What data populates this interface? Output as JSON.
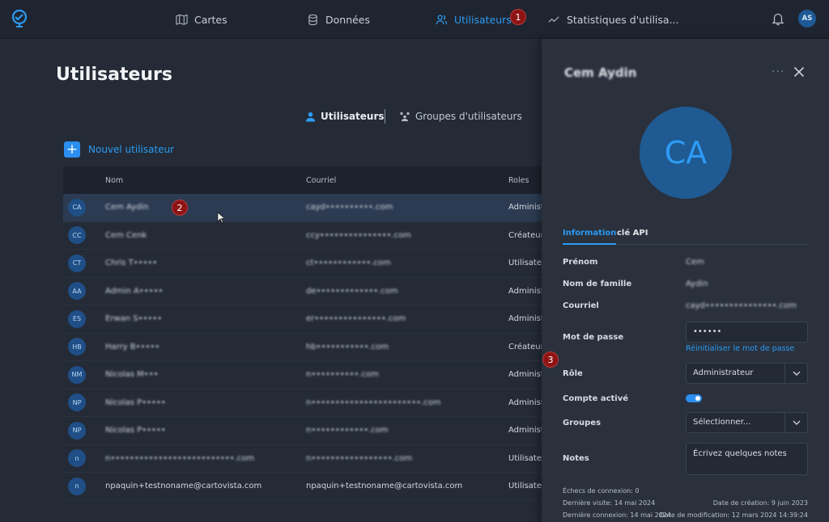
{
  "nav": {
    "items": [
      {
        "label": "Cartes",
        "icon": "map-icon"
      },
      {
        "label": "Données",
        "icon": "database-icon"
      },
      {
        "label": "Utilisateurs",
        "icon": "users-icon"
      },
      {
        "label": "Statistiques d'utilisa...",
        "icon": "stats-icon"
      }
    ],
    "user_initials": "AS"
  },
  "markers": [
    "1",
    "2",
    "3"
  ],
  "page": {
    "title": "Utilisateurs",
    "tab_users": "Utilisateurs",
    "tab_groups": "Groupes d'utilisateurs",
    "new_user": "Nouvel utilisateur"
  },
  "table": {
    "headers": [
      "Nom",
      "Courriel",
      "Roles"
    ],
    "rows": [
      {
        "initials": "CA",
        "name": "Cem Aydin",
        "email": "cayd••••••••••.com",
        "role": "Administrateur",
        "blur": true
      },
      {
        "initials": "CC",
        "name": "Cem Cenk",
        "email": "ccy•••••••••••••••.com",
        "role": "Créateur",
        "blur": true
      },
      {
        "initials": "CT",
        "name": "Chris T•••••",
        "email": "ct••••••••••••.com",
        "role": "Utilisateur",
        "blur": true
      },
      {
        "initials": "AA",
        "name": "Admin A•••••",
        "email": "de•••••••••••••.com",
        "role": "Administrateur",
        "blur": true
      },
      {
        "initials": "ES",
        "name": "Erwan S•••••",
        "email": "er•••••••••••••••.com",
        "role": "Administrateur",
        "blur": true
      },
      {
        "initials": "HB",
        "name": "Harry B•••••",
        "email": "hb•••••••••••.com",
        "role": "Créateur",
        "blur": true
      },
      {
        "initials": "NM",
        "name": "Nicolas M•••",
        "email": "n••••••••••.com",
        "role": "Administrateur",
        "blur": true
      },
      {
        "initials": "NP",
        "name": "Nicolas P•••••",
        "email": "n•••••••••••••••••••••••.com",
        "role": "Administrateur",
        "blur": true
      },
      {
        "initials": "NP",
        "name": "Nicolas P•••••",
        "email": "n••••••••••••.com",
        "role": "Administrateur",
        "blur": true
      },
      {
        "initials": "n",
        "name": "n••••••••••••••••••••••••••.com",
        "email": "n•••••••••••••••••.com",
        "role": "Utilisateur",
        "blur": true
      },
      {
        "initials": "n",
        "name": "npaquin+testnoname@cartovista.com",
        "email": "npaquin+testnoname@cartovista.com",
        "role": "Utilisateur",
        "blur": false
      }
    ]
  },
  "panel": {
    "title": "Cem Aydin",
    "dots": "···",
    "avatar_initials": "CA",
    "tab_info": "Information",
    "tab_api": "clé API",
    "fields": {
      "first_name_label": "Prénom",
      "first_name": "Cem",
      "last_name_label": "Nom de famille",
      "last_name": "Aydin",
      "email_label": "Courriel",
      "email": "cayd•••••••••••••••.com",
      "password_label": "Mot de passe",
      "password": "••••••",
      "reset_password": "Réinitialiser le mot de passe",
      "role_label": "Rôle",
      "role": "Administrateur",
      "active_label": "Compte activé",
      "groups_label": "Groupes",
      "groups": "Sélectionner...",
      "notes_label": "Notes",
      "notes_placeholder": "Écrivez quelques notes"
    },
    "account_active": true,
    "meta": {
      "failed": "Échecs de connexion: 0",
      "last_visit": "Dernière visite: 14 mai 2024",
      "last_login": "Dernière connexion: 14 mai 2024",
      "created": "Date de création: 9 juin 2023",
      "modified": "Date de modification: 12 mars 2024 14:39:24"
    }
  },
  "colors": {
    "accent": "#2b9bf4",
    "marker": "#8e1414",
    "panel": "#2a313d"
  }
}
